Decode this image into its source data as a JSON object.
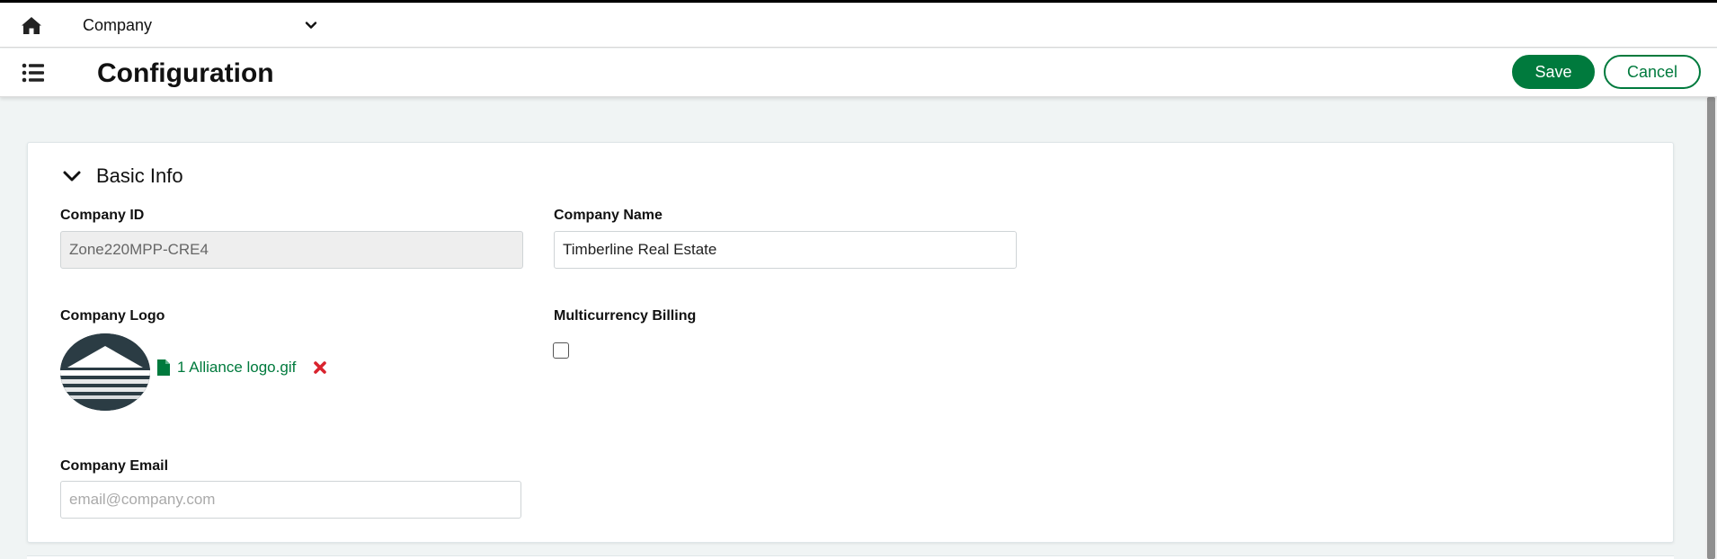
{
  "topbar": {
    "company_selector": "Company"
  },
  "header": {
    "title": "Configuration",
    "save_label": "Save",
    "cancel_label": "Cancel"
  },
  "section": {
    "title": "Basic Info"
  },
  "fields": {
    "company_id_label": "Company ID",
    "company_id_value": "Zone220MPP-CRE4",
    "company_name_label": "Company Name",
    "company_name_value": "Timberline Real Estate",
    "company_logo_label": "Company Logo",
    "logo_file_name": "1 Alliance logo.gif",
    "multicurrency_label": "Multicurrency Billing",
    "multicurrency_checked": false,
    "company_email_label": "Company Email",
    "company_email_placeholder": "email@company.com"
  },
  "colors": {
    "accent": "#007a3d",
    "remove": "#d9232e",
    "background": "#f0f4f4"
  },
  "icons": {
    "home": "home-icon",
    "menu": "list-menu-icon",
    "dropdown": "chevron-down-icon",
    "section_toggle": "chevron-down-icon",
    "file": "file-icon",
    "remove": "remove-x-icon"
  }
}
